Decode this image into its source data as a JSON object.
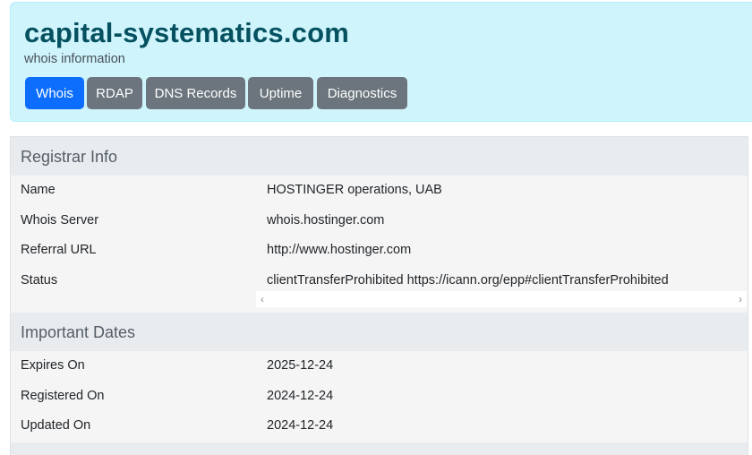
{
  "header": {
    "title": "capital-systematics.com",
    "subtitle": "whois information",
    "tabs": [
      {
        "label": "Whois",
        "active": true
      },
      {
        "label": "RDAP",
        "active": false
      },
      {
        "label": "DNS Records",
        "active": false
      },
      {
        "label": "Uptime",
        "active": false
      },
      {
        "label": "Diagnostics",
        "active": false
      }
    ]
  },
  "registrar": {
    "heading": "Registrar Info",
    "rows": [
      {
        "key": "Name",
        "value": "HOSTINGER operations, UAB"
      },
      {
        "key": "Whois Server",
        "value": "whois.hostinger.com"
      },
      {
        "key": "Referral URL",
        "value": "http://www.hostinger.com"
      },
      {
        "key": "Status",
        "value": "clientTransferProhibited https://icann.org/epp#clientTransferProhibited"
      }
    ]
  },
  "dates": {
    "heading": "Important Dates",
    "rows": [
      {
        "key": "Expires On",
        "value": "2025-12-24"
      },
      {
        "key": "Registered On",
        "value": "2024-12-24"
      },
      {
        "key": "Updated On",
        "value": "2024-12-24"
      }
    ]
  },
  "colors": {
    "header_bg": "#cff4fc",
    "title": "#055160",
    "active_tab": "#0d6efd",
    "tab": "#6c757d"
  },
  "icons": {
    "scroll_left": "scroll-left-arrow-icon",
    "scroll_right": "scroll-right-arrow-icon"
  }
}
